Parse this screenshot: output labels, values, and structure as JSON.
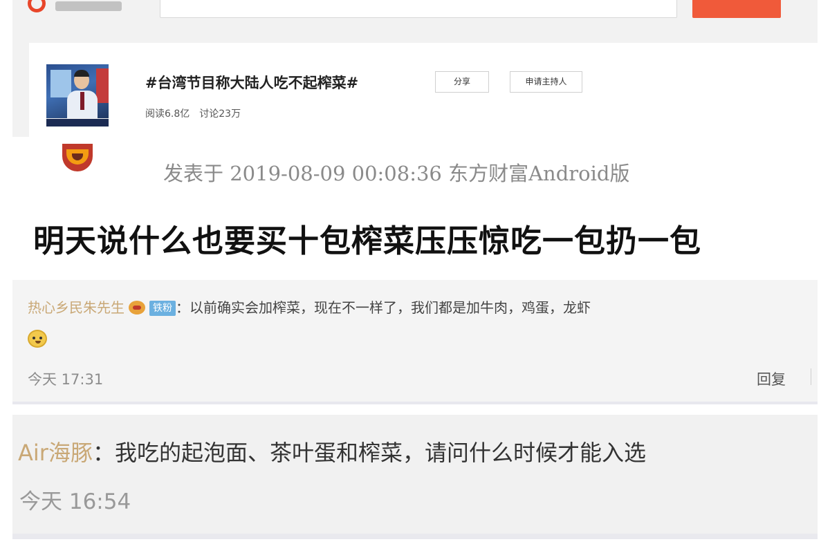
{
  "topic": {
    "title": "#台湾节目称大陆人吃不起榨菜#",
    "share_label": "分享",
    "host_label": "申请主持人",
    "reads": "阅读6.8亿",
    "discussions": "讨论23万"
  },
  "post": {
    "meta": "发表于 2019-08-09 00:08:36 东方财富Android版",
    "content": "明天说什么也要买十包榨菜压压惊吃一包扔一包"
  },
  "comments": [
    {
      "username": "热心乡民朱先生",
      "badge": "铁粉",
      "separator": "：",
      "text": "以前确实会加榨菜，现在不一样了，我们都是加牛肉，鸡蛋，龙虾",
      "time": "今天 17:31",
      "reply_label": "回复"
    },
    {
      "username": "Air海豚",
      "separator": "：",
      "text": "我吃的起泡面、茶叶蛋和榨菜，请问什么时候才能入选",
      "time": "今天 16:54"
    }
  ],
  "colors": {
    "accent": "#f05a3a",
    "username": "#c9a876",
    "fan_badge": "#6bb0e0"
  }
}
